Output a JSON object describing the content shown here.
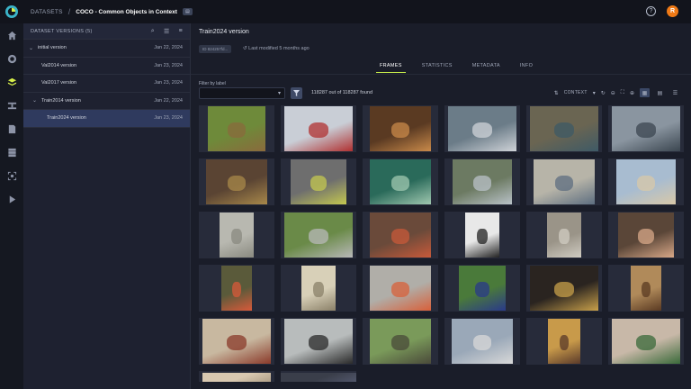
{
  "header": {
    "root": "DATASETS",
    "separator": "/",
    "project": "COCO - Common Objects in Context",
    "project_tag": "▤",
    "help": "?",
    "avatar_initial": "R"
  },
  "versions": {
    "title": "DATASET VERSIONS (5)",
    "items": [
      {
        "name": "initial version",
        "date": "Jan 22, 2024",
        "expander": "⌄"
      },
      {
        "name": "Val2014 version",
        "date": "Jan 23, 2024",
        "expander": ""
      },
      {
        "name": "Val2017 version",
        "date": "Jan 23, 2024",
        "expander": ""
      },
      {
        "name": "Train2014 version",
        "date": "Jan 22, 2024",
        "expander": "⌄"
      },
      {
        "name": "Train2024 version",
        "date": "Jan 23, 2024",
        "expander": ""
      }
    ]
  },
  "main": {
    "title": "Train2024 version",
    "id_badge": "ID 824257fd...",
    "modified": "Last modified 5 months ago",
    "tabs": [
      "FRAMES",
      "STATISTICS",
      "METADATA",
      "INFO"
    ],
    "filter_label": "Filter by label",
    "count": "118287 out of 118287 found",
    "context_label": "CONTEXT"
  },
  "colors": {
    "accent": "#c3e84a",
    "avatar": "#f07a16",
    "selected_row": "#2f3a5e"
  },
  "thumbnails": [
    {
      "name": "horse-field",
      "bg": "#6e8a3a",
      "fg": "#8a6a3c"
    },
    {
      "name": "skier-snow",
      "bg": "#c9ced6",
      "fg": "#b03030"
    },
    {
      "name": "donuts",
      "bg": "#5a3a22",
      "fg": "#c98a4a"
    },
    {
      "name": "boat-beach",
      "bg": "#6b7c88",
      "fg": "#cfd3d8"
    },
    {
      "name": "suitcase-ground",
      "bg": "#6a6552",
      "fg": "#3e5a66"
    },
    {
      "name": "train-station",
      "bg": "#8a95a0",
      "fg": "#3b4650"
    },
    {
      "name": "market-stall",
      "bg": "#5a4433",
      "fg": "#a8884a"
    },
    {
      "name": "street-skateboard",
      "bg": "#6e6e6e",
      "fg": "#c4c850"
    },
    {
      "name": "train-interior",
      "bg": "#2a6a5a",
      "fg": "#a0c8b0"
    },
    {
      "name": "street-sign",
      "bg": "#6c7a62",
      "fg": "#b9c2c8"
    },
    {
      "name": "beach-people",
      "bg": "#b7b4a8",
      "fg": "#5d6e80"
    },
    {
      "name": "kites-beach",
      "bg": "#a8bcd0",
      "fg": "#d8c8a8"
    },
    {
      "name": "bathroom",
      "bg": "#b8b8b0",
      "fg": "#8a8a80"
    },
    {
      "name": "park-road",
      "bg": "#6a8a48",
      "fg": "#b8b8b8"
    },
    {
      "name": "hotdog",
      "bg": "#6a4a3a",
      "fg": "#c85a3a"
    },
    {
      "name": "checkered-hand",
      "bg": "#e8e8e8",
      "fg": "#222222"
    },
    {
      "name": "fridge-room",
      "bg": "#9a9488",
      "fg": "#d0ccc2"
    },
    {
      "name": "man-eating",
      "bg": "#5a4638",
      "fg": "#d8a888"
    },
    {
      "name": "fruit-market",
      "bg": "#5a5a3a",
      "fg": "#d85a3a"
    },
    {
      "name": "old-photo",
      "bg": "#d8d0b8",
      "fg": "#8a8068"
    },
    {
      "name": "construction",
      "bg": "#b0aea8",
      "fg": "#d8603a"
    },
    {
      "name": "team-photo",
      "bg": "#4a7a3a",
      "fg": "#2a3a8a"
    },
    {
      "name": "salad-bowl",
      "bg": "#2a2420",
      "fg": "#c8a04a"
    },
    {
      "name": "doorway-person",
      "bg": "#b08a5a",
      "fg": "#5a3a22"
    },
    {
      "name": "bedroom",
      "bg": "#c8b8a0",
      "fg": "#8a3a2a"
    },
    {
      "name": "birds-water",
      "bg": "#b8bcbc",
      "fg": "#2a2a2a"
    },
    {
      "name": "field-animals",
      "bg": "#7a9a5a",
      "fg": "#4a4a3a"
    },
    {
      "name": "airport",
      "bg": "#9aa8b8",
      "fg": "#d8d8d8"
    },
    {
      "name": "hall-people",
      "bg": "#c89a4a",
      "fg": "#5a3a2a"
    },
    {
      "name": "watermelon-man",
      "bg": "#c8b8a8",
      "fg": "#3a6a3a"
    },
    {
      "name": "partial-1",
      "bg": "#d8c8b0",
      "fg": "#b0a088"
    },
    {
      "name": "partial-2",
      "bg": "#3a3e4a",
      "fg": "#50556a"
    }
  ]
}
